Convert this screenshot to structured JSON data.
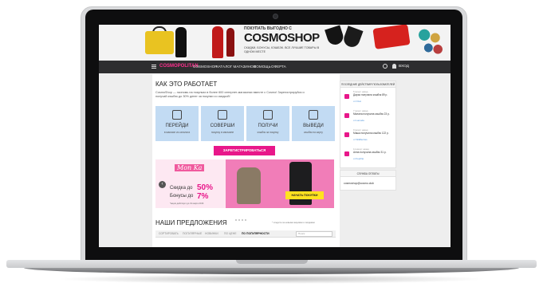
{
  "banner": {
    "pre": "ПОКУПАТЬ ВЫГОДНО С",
    "logo": "COSMOSHOP",
    "sub": "СКИДКИ, БОНУСЫ, КЭШБЭК. ВСЕ ЛУЧШИЕ ТОВАРЫ В ОДНОМ МЕСТЕ"
  },
  "nav": {
    "logo": "COSMOPOLITAN",
    "items": [
      "COSMOSHOP",
      "КАТАЛОГ МАГАЗИНОВ",
      "ПОМОЩЬ",
      "ОФЕРТА"
    ],
    "login": "ВХОД"
  },
  "how": {
    "title": "КАК ЭТО РАБОТАЕТ",
    "intro": "CosmoShop — экономь на покупках в более 600 интернет-магазинах вместе с Cosmo! Зарегистрируйся и получай кэшбэк до 30% денег за покупки со скидкой!",
    "steps": [
      {
        "title": "ПЕРЕЙДИ",
        "sub": "в магазин из каталога"
      },
      {
        "title": "СОВЕРШИ",
        "sub": "покупку в магазине"
      },
      {
        "title": "ПОЛУЧИ",
        "sub": "кэшбэк за покупку"
      },
      {
        "title": "ВЫВЕДИ",
        "sub": "кэшбэк на карту"
      }
    ],
    "register": "ЗАРЕГИСТРИРОВАТЬСЯ"
  },
  "promo": {
    "brand": "Mon Ka",
    "line1": "Скидка до",
    "val1": "50%",
    "line2": "Бонусы до",
    "val2": "7%",
    "fine": "*акция действует до 31 марта 2016",
    "button": "НАЧАТЬ ПОКУПКИ"
  },
  "offers": {
    "title": "НАШИ ПРЕДЛОЖЕНИЯ",
    "note": "* следите за новыми акциями и скидками",
    "tabs": [
      "СОРТИРОВАТЬ",
      "ПОПУЛЯРНЫЕ",
      "НОВИНКИ",
      "ПО ЦЕНЕ",
      "ПО ПОПУЛЯРНОСТИ"
    ],
    "active_tab": 4,
    "search_placeholder": "Поиск"
  },
  "sidebar": {
    "recent_title": "ПОСЛЕДНИЕ ДЕЙСТВИЯ ПОЛЬЗОВАТЕЛЕЙ",
    "items": [
      {
        "date": "5 минут назад",
        "text": "Дарья получила кэшбэк 89 р.",
        "meta": "от Ozon"
      },
      {
        "date": "7 минут назад",
        "text": "Милана получила кэшбэк 23 р.",
        "meta": "от Lamoda"
      },
      {
        "date": "9 минут назад",
        "text": "Маша получила кэшбэк 122 р.",
        "meta": "от Wildberries"
      },
      {
        "date": "11 минут назад",
        "text": "Анна получила кэшбэк 31 р.",
        "meta": "от KupiVip"
      }
    ],
    "support_title": "СЛУЖБА ОПЛАТЫ",
    "email": "cosmoshop@cosmo.club"
  },
  "colors": {
    "accent": "#e8178a",
    "nav_bg": "#2d2d2f",
    "step_bg": "#c2dbf3",
    "promo_bg": "#f17db8",
    "promo_button": "#ffe21f"
  }
}
